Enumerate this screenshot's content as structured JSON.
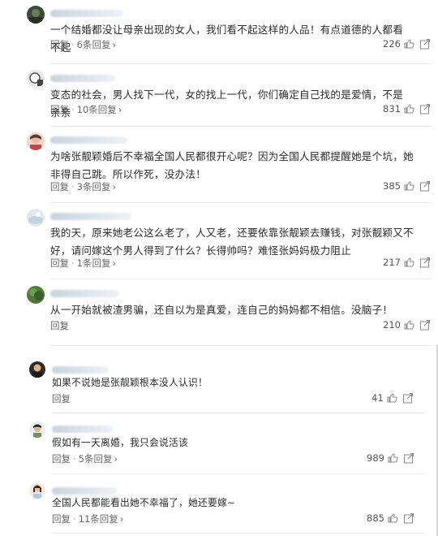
{
  "comments": [
    {
      "text": "一个结婚都没让母亲出现的女人，我们看不起这样的人品！有点道德的人都看不起",
      "reply_label": "回复",
      "replies": "6条回复",
      "likes": "226"
    },
    {
      "text": "变态的社会，男人找下一代，女的找上一代，你们确定自己找的是爱情，不是亲亲",
      "reply_label": "回复",
      "replies": "10条回复",
      "likes": "831"
    },
    {
      "text": "为啥张靓颖婚后不幸福全国人民都很开心呢？因为全国人民都提醒她是个坑，她非得自己跳。所以作死，没办法！",
      "reply_label": "回复",
      "replies": "3条回复",
      "likes": "385"
    },
    {
      "text": "我的天，原来她老公这么老了，人又老，还要依靠张靓颖去赚钱，对张靓颖又不好，请问嫁这个男人得到了什么？长得帅吗？难怪张妈妈极力阻止",
      "reply_label": "回复",
      "replies": "1条回复",
      "likes": "217"
    },
    {
      "text": "从一开始就被渣男骗，还自以为是真爱，连自己的妈妈都不相信。没脑子！",
      "reply_label": "回复",
      "replies": "",
      "likes": "210"
    },
    {
      "text": "如果不说她是张靓颖根本没人认识！",
      "reply_label": "回复",
      "replies": "",
      "likes": "41"
    },
    {
      "text": "假如有一天离婚，我只会说活该",
      "reply_label": "回复",
      "replies": "5条回复",
      "likes": "989"
    },
    {
      "text": "全国人民都能看出她不幸福了，她还要嫁~",
      "reply_label": "回复",
      "replies": "11条回复",
      "likes": "885"
    }
  ],
  "icons": {
    "like": "thumbs-up-icon",
    "share": "share-icon",
    "reply_arrow": "chevron-right-icon"
  },
  "colors": {
    "text": "#2b2b2b",
    "meta": "#666666",
    "divider": "#e6e6e6"
  }
}
